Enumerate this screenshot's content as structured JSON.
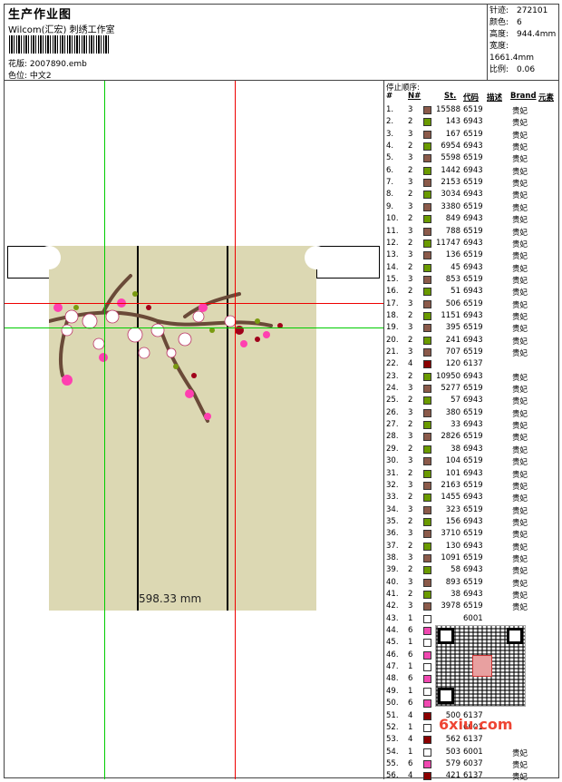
{
  "header": {
    "title": "生产作业图",
    "studio": "Wilcom(汇宏) 刺绣工作室",
    "design_file_label": "花版:",
    "design_file": "2007890.emb",
    "color_pos_label": "色位:",
    "color_pos": "中文2"
  },
  "stats": [
    {
      "label": "针迹:",
      "value": "272101"
    },
    {
      "label": "颜色:",
      "value": "6"
    },
    {
      "label": "高度:",
      "value": "944.4mm"
    },
    {
      "label": "宽度:",
      "value": "1661.4mm"
    },
    {
      "label": "比例:",
      "value": "0.06"
    }
  ],
  "preview": {
    "dimension_label": "598.33 mm"
  },
  "stop_list": {
    "title": "停止顺序:",
    "columns": [
      "#",
      "N#",
      "St.",
      "代码",
      "描述",
      "Brand",
      "元素"
    ],
    "brand_default": "贵妃",
    "colors": {
      "6519": "#8b5a4a",
      "6943": "#6a9a00",
      "6137": "#8b0000",
      "6001": "#ffffff",
      "6037": "#f048b0"
    },
    "rows": [
      {
        "n": "1.",
        "nn": "3",
        "st": "15588",
        "code": "6519",
        "brand": "贵妃"
      },
      {
        "n": "2.",
        "nn": "2",
        "st": "143",
        "code": "6943",
        "brand": "贵妃"
      },
      {
        "n": "3.",
        "nn": "3",
        "st": "167",
        "code": "6519",
        "brand": "贵妃"
      },
      {
        "n": "4.",
        "nn": "2",
        "st": "6954",
        "code": "6943",
        "brand": "贵妃"
      },
      {
        "n": "5.",
        "nn": "3",
        "st": "5598",
        "code": "6519",
        "brand": "贵妃"
      },
      {
        "n": "6.",
        "nn": "2",
        "st": "1442",
        "code": "6943",
        "brand": "贵妃"
      },
      {
        "n": "7.",
        "nn": "3",
        "st": "2153",
        "code": "6519",
        "brand": "贵妃"
      },
      {
        "n": "8.",
        "nn": "2",
        "st": "3034",
        "code": "6943",
        "brand": "贵妃"
      },
      {
        "n": "9.",
        "nn": "3",
        "st": "3380",
        "code": "6519",
        "brand": "贵妃"
      },
      {
        "n": "10.",
        "nn": "2",
        "st": "849",
        "code": "6943",
        "brand": "贵妃"
      },
      {
        "n": "11.",
        "nn": "3",
        "st": "788",
        "code": "6519",
        "brand": "贵妃"
      },
      {
        "n": "12.",
        "nn": "2",
        "st": "11747",
        "code": "6943",
        "brand": "贵妃"
      },
      {
        "n": "13.",
        "nn": "3",
        "st": "136",
        "code": "6519",
        "brand": "贵妃"
      },
      {
        "n": "14.",
        "nn": "2",
        "st": "45",
        "code": "6943",
        "brand": "贵妃"
      },
      {
        "n": "15.",
        "nn": "3",
        "st": "853",
        "code": "6519",
        "brand": "贵妃"
      },
      {
        "n": "16.",
        "nn": "2",
        "st": "51",
        "code": "6943",
        "brand": "贵妃"
      },
      {
        "n": "17.",
        "nn": "3",
        "st": "506",
        "code": "6519",
        "brand": "贵妃"
      },
      {
        "n": "18.",
        "nn": "2",
        "st": "1151",
        "code": "6943",
        "brand": "贵妃"
      },
      {
        "n": "19.",
        "nn": "3",
        "st": "395",
        "code": "6519",
        "brand": "贵妃"
      },
      {
        "n": "20.",
        "nn": "2",
        "st": "241",
        "code": "6943",
        "brand": "贵妃"
      },
      {
        "n": "21.",
        "nn": "3",
        "st": "707",
        "code": "6519",
        "brand": "贵妃"
      },
      {
        "n": "22.",
        "nn": "4",
        "st": "120",
        "code": "6137",
        "brand": ""
      },
      {
        "n": "23.",
        "nn": "2",
        "st": "10950",
        "code": "6943",
        "brand": "贵妃"
      },
      {
        "n": "24.",
        "nn": "3",
        "st": "5277",
        "code": "6519",
        "brand": "贵妃"
      },
      {
        "n": "25.",
        "nn": "2",
        "st": "57",
        "code": "6943",
        "brand": "贵妃"
      },
      {
        "n": "26.",
        "nn": "3",
        "st": "380",
        "code": "6519",
        "brand": "贵妃"
      },
      {
        "n": "27.",
        "nn": "2",
        "st": "33",
        "code": "6943",
        "brand": "贵妃"
      },
      {
        "n": "28.",
        "nn": "3",
        "st": "2826",
        "code": "6519",
        "brand": "贵妃"
      },
      {
        "n": "29.",
        "nn": "2",
        "st": "38",
        "code": "6943",
        "brand": "贵妃"
      },
      {
        "n": "30.",
        "nn": "3",
        "st": "104",
        "code": "6519",
        "brand": "贵妃"
      },
      {
        "n": "31.",
        "nn": "2",
        "st": "101",
        "code": "6943",
        "brand": "贵妃"
      },
      {
        "n": "32.",
        "nn": "3",
        "st": "2163",
        "code": "6519",
        "brand": "贵妃"
      },
      {
        "n": "33.",
        "nn": "2",
        "st": "1455",
        "code": "6943",
        "brand": "贵妃"
      },
      {
        "n": "34.",
        "nn": "3",
        "st": "323",
        "code": "6519",
        "brand": "贵妃"
      },
      {
        "n": "35.",
        "nn": "2",
        "st": "156",
        "code": "6943",
        "brand": "贵妃"
      },
      {
        "n": "36.",
        "nn": "3",
        "st": "3710",
        "code": "6519",
        "brand": "贵妃"
      },
      {
        "n": "37.",
        "nn": "2",
        "st": "130",
        "code": "6943",
        "brand": "贵妃"
      },
      {
        "n": "38.",
        "nn": "3",
        "st": "1091",
        "code": "6519",
        "brand": "贵妃"
      },
      {
        "n": "39.",
        "nn": "2",
        "st": "58",
        "code": "6943",
        "brand": "贵妃"
      },
      {
        "n": "40.",
        "nn": "3",
        "st": "893",
        "code": "6519",
        "brand": "贵妃"
      },
      {
        "n": "41.",
        "nn": "2",
        "st": "38",
        "code": "6943",
        "brand": "贵妃"
      },
      {
        "n": "42.",
        "nn": "3",
        "st": "3978",
        "code": "6519",
        "brand": "贵妃"
      },
      {
        "n": "43.",
        "nn": "1",
        "st": "",
        "code": "6001",
        "brand": ""
      },
      {
        "n": "44.",
        "nn": "6",
        "st": "",
        "code": "6037",
        "brand": ""
      },
      {
        "n": "45.",
        "nn": "1",
        "st": "",
        "code": "6001",
        "brand": ""
      },
      {
        "n": "46.",
        "nn": "6",
        "st": "",
        "code": "6037",
        "brand": ""
      },
      {
        "n": "47.",
        "nn": "1",
        "st": "",
        "code": "6001",
        "brand": ""
      },
      {
        "n": "48.",
        "nn": "6",
        "st": "",
        "code": "6037",
        "brand": ""
      },
      {
        "n": "49.",
        "nn": "1",
        "st": "",
        "code": "6001",
        "brand": ""
      },
      {
        "n": "50.",
        "nn": "6",
        "st": "",
        "code": "6037",
        "brand": ""
      },
      {
        "n": "51.",
        "nn": "4",
        "st": "500",
        "code": "6137",
        "brand": ""
      },
      {
        "n": "52.",
        "nn": "1",
        "st": "",
        "code": "6001",
        "brand": ""
      },
      {
        "n": "53.",
        "nn": "4",
        "st": "562",
        "code": "6137",
        "brand": ""
      },
      {
        "n": "54.",
        "nn": "1",
        "st": "503",
        "code": "6001",
        "brand": "贵妃"
      },
      {
        "n": "55.",
        "nn": "6",
        "st": "579",
        "code": "6037",
        "brand": "贵妃"
      },
      {
        "n": "56.",
        "nn": "4",
        "st": "421",
        "code": "6137",
        "brand": "贵妃"
      }
    ]
  },
  "watermark": "6xiu.com"
}
